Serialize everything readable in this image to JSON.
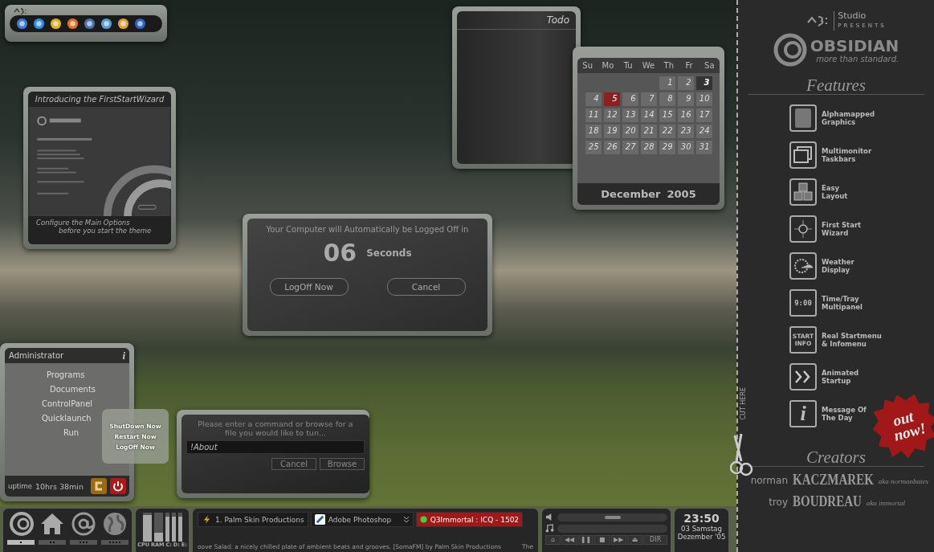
{
  "launcher": {
    "apps": [
      {
        "color": "#3a7bd5"
      },
      {
        "color": "#2a8fe0"
      },
      {
        "color": "#e0b020"
      },
      {
        "color": "#e07020"
      },
      {
        "color": "#4a70b0"
      },
      {
        "color": "#5a9ad0"
      },
      {
        "color": "#e0a030"
      },
      {
        "color": "#3060c0"
      }
    ]
  },
  "wizard": {
    "title": "Introducing the FirstStartWizard",
    "caption_lines": [
      "Configure the Main Options",
      "before you start the theme"
    ]
  },
  "todo": {
    "title": "Todo"
  },
  "calendar": {
    "weekdays": [
      "Su",
      "Mo",
      "Tu",
      "We",
      "Th",
      "Fr",
      "Sa"
    ],
    "weeks": [
      [
        {
          "label": "1",
          "selected": false,
          "today": false
        },
        {
          "label": "2",
          "selected": false,
          "today": false
        },
        {
          "label": "3",
          "selected": false,
          "today": true
        }
      ],
      [
        {
          "label": "4",
          "selected": false,
          "today": false
        },
        {
          "label": "5",
          "selected": true,
          "today": false
        },
        {
          "label": "6",
          "selected": false,
          "today": false
        },
        {
          "label": "7",
          "selected": false,
          "today": false
        },
        {
          "label": "8",
          "selected": false,
          "today": false
        },
        {
          "label": "9",
          "selected": false,
          "today": false
        },
        {
          "label": "10",
          "selected": false,
          "today": false
        }
      ],
      [
        {
          "label": "11",
          "selected": false,
          "today": false
        },
        {
          "label": "12",
          "selected": false,
          "today": false
        },
        {
          "label": "13",
          "selected": false,
          "today": false
        },
        {
          "label": "14",
          "selected": false,
          "today": false
        },
        {
          "label": "15",
          "selected": false,
          "today": false
        },
        {
          "label": "16",
          "selected": false,
          "today": false
        },
        {
          "label": "17",
          "selected": false,
          "today": false
        }
      ],
      [
        {
          "label": "18",
          "selected": false,
          "today": false
        },
        {
          "label": "19",
          "selected": false,
          "today": false
        },
        {
          "label": "20",
          "selected": false,
          "today": false
        },
        {
          "label": "21",
          "selected": false,
          "today": false
        },
        {
          "label": "22",
          "selected": false,
          "today": false
        },
        {
          "label": "23",
          "selected": false,
          "today": false
        },
        {
          "label": "24",
          "selected": false,
          "today": false
        }
      ],
      [
        {
          "label": "25",
          "selected": false,
          "today": false
        },
        {
          "label": "26",
          "selected": false,
          "today": false
        },
        {
          "label": "27",
          "selected": false,
          "today": false
        },
        {
          "label": "28",
          "selected": false,
          "today": false
        },
        {
          "label": "29",
          "selected": false,
          "today": false
        },
        {
          "label": "30",
          "selected": false,
          "today": false
        },
        {
          "label": "31",
          "selected": false,
          "today": false
        }
      ]
    ],
    "month": "December",
    "year": "2005"
  },
  "logoff_dialog": {
    "message": "Your Computer will Automatically be Logged Off in",
    "count": "06",
    "unit": "Seconds",
    "buttons": [
      "LogOff Now",
      "Cancel"
    ]
  },
  "start_menu": {
    "user": "Administrator",
    "info_glyph": "i",
    "items": [
      "Programs",
      "Documents",
      "ControlPanel",
      "Quicklaunch",
      "Run"
    ],
    "uptime_label": "uptime",
    "uptime": "10hrs 38min"
  },
  "power_menu": {
    "items": [
      "ShutDown Now",
      "Restart Now",
      "LogOff Now"
    ]
  },
  "run_dialog": {
    "prompt": "Please enter a command or browse for a file you would like to tun...",
    "value": "!About",
    "buttons": [
      "Cancel",
      "Browse"
    ]
  },
  "taskbar": {
    "quick_icons": [
      {
        "kind": "rings",
        "selected": true
      },
      {
        "kind": "home",
        "selected": false
      },
      {
        "kind": "at",
        "selected": false
      },
      {
        "kind": "globe",
        "selected": false
      }
    ],
    "meters": [
      {
        "label": "CPU",
        "level": 0.92
      },
      {
        "label": "RAM",
        "level": 0.3
      },
      {
        "label": "C:",
        "level": 0.85
      },
      {
        "label": "D:",
        "level": 0.85
      },
      {
        "label": "E:",
        "level": 0.85
      }
    ],
    "tasks": [
      {
        "label": "1. Palm Skin Productions",
        "kind": "bolt",
        "alert": false
      },
      {
        "label": "Adobe Photoshop",
        "kind": "photoshop",
        "alert": false
      },
      {
        "label": "Q3Immortal : ICQ - 1502",
        "kind": "icq",
        "alert": true
      }
    ],
    "ticker": "oove Salad: a nicely chilled plate of ambient beats and grooves. [SomaFM] by Palm Skin Productions",
    "ticker_tail": "The",
    "player": {
      "volume": {
        "level": 0.5
      },
      "buttons": [
        "⌂",
        "◀◀",
        "❚❚",
        "■",
        "▶▶",
        "⏏",
        "DIR"
      ]
    },
    "clock": {
      "time": "23:50",
      "day": "03 Samstag",
      "month": "Dezember '05"
    }
  },
  "promo": {
    "studio": "Studio",
    "presents": "PRESENTS",
    "product": "OBSIDIAN",
    "slogan": "more than standard.",
    "features_heading": "Features",
    "features": [
      {
        "kind": "alpha",
        "lines": [
          "Alphamapped",
          "Graphics"
        ]
      },
      {
        "kind": "monitors",
        "lines": [
          "Multimonitor",
          "Taskbars"
        ]
      },
      {
        "kind": "cubes",
        "lines": [
          "Easy",
          "Layout"
        ]
      },
      {
        "kind": "crosshair",
        "lines": [
          "First Start",
          "Wizard"
        ]
      },
      {
        "kind": "weather",
        "lines": [
          "Weather",
          "Display"
        ]
      },
      {
        "kind": "clock",
        "icon_text": [
          "9:00"
        ],
        "lines": [
          "Time/Tray",
          "Multipanel"
        ]
      },
      {
        "kind": "text",
        "icon_text": [
          "START",
          "INFO"
        ],
        "lines": [
          "Real Startmenu",
          "& Infomenu"
        ]
      },
      {
        "kind": "arrows",
        "lines": [
          "Animated",
          "Startup"
        ]
      },
      {
        "kind": "info",
        "icon_text": [
          "i"
        ],
        "lines": [
          "Message Of",
          "The Day"
        ]
      }
    ],
    "cut_label": "CUT HERE",
    "badge_lines": [
      "out",
      "now!"
    ],
    "creators_heading": "Creators",
    "creators": [
      {
        "first": "norman",
        "last": "KACZMAREK",
        "aka": "aka normanbates"
      },
      {
        "first": "troy",
        "last": "BOUDREAU",
        "aka": "aka immortal"
      }
    ]
  }
}
